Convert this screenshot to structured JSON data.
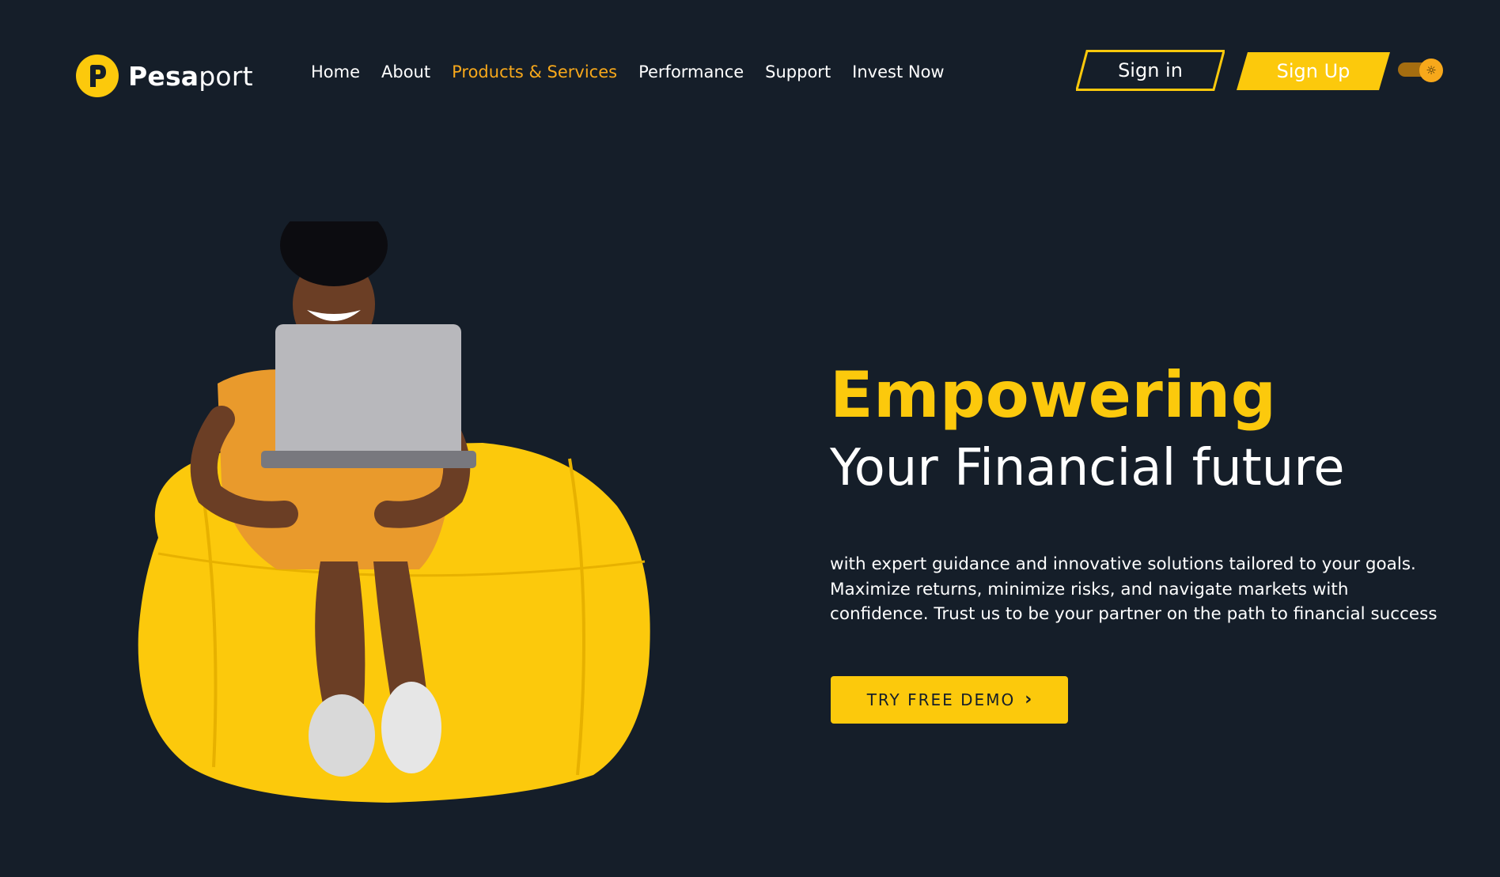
{
  "brand": {
    "name_bold": "Pesa",
    "name_light": "port",
    "logo_letter": "P",
    "logo_icon": "p-logo-icon",
    "accent_color": "#fcc90c",
    "active_nav_color": "#f7a81b",
    "background_color": "#151e29"
  },
  "nav": {
    "items": [
      {
        "label": "Home",
        "active": false
      },
      {
        "label": "About",
        "active": false
      },
      {
        "label": "Products & Services",
        "active": true
      },
      {
        "label": "Performance",
        "active": false
      },
      {
        "label": "Support",
        "active": false
      },
      {
        "label": "Invest Now",
        "active": false
      }
    ]
  },
  "auth": {
    "signin_label": "Sign in",
    "signup_label": "Sign Up"
  },
  "theme_toggle": {
    "icon": "sun-icon",
    "glyph": "☼"
  },
  "hero": {
    "image_description": "Smiling woman with laptop sitting on a yellow bean bag",
    "title": "Empowering",
    "subtitle": "Your Financial future",
    "description_lines": [
      "with expert guidance and innovative solutions tailored to your goals.",
      "Maximize returns, minimize risks, and navigate markets with",
      "confidence. Trust us to be your partner on the path to financial success"
    ],
    "cta_label": "TRY FREE DEMO",
    "cta_icon_glyph": "›",
    "cta_icon": "chevron-right-icon"
  }
}
